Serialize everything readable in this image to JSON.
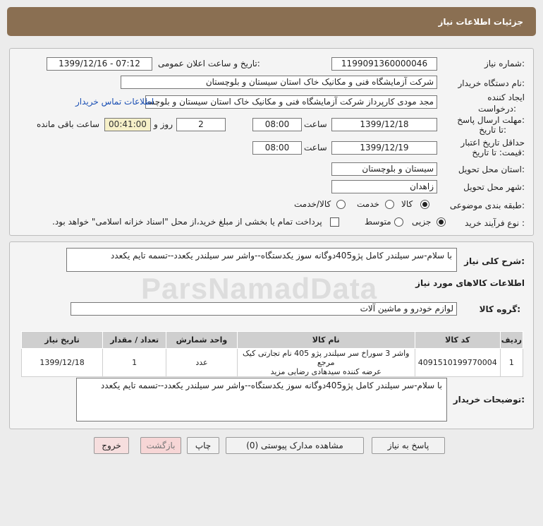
{
  "header": {
    "title": "جزئیات اطلاعات نیاز"
  },
  "info": {
    "need_number_label": "شماره نیاز:",
    "need_number": "1199091360000046",
    "announce_label": "تاریخ و ساعت اعلان عمومی:",
    "announce_value": "1399/12/16 - 07:12",
    "buyer_label": "نام دستگاه خریدار:",
    "buyer_value": "شرکت آزمایشگاه فنی و مکانیک خاک استان سیستان و بلوچستان",
    "creator_label_1": "ایجاد کننده",
    "creator_label_2": "درخواست:",
    "creator_value": "مجد مودی کارپرداز شرکت آزمایشگاه فنی و مکانیک خاک استان سیستان و بلوچستان",
    "contact_link": "اطلاعات تماس خریدار",
    "deadline_label_1": "مهلت ارسال پاسخ:",
    "deadline_label_2": "تا تاریخ:",
    "deadline_date": "1399/12/18",
    "time_label": "ساعت",
    "deadline_time": "08:00",
    "days_value": "2",
    "days_label": "روز و",
    "remaining_time": "00:41:00",
    "remaining_label": "ساعت باقی مانده",
    "validity_label_1": "حداقل تاریخ اعتبار",
    "validity_label_2": "قیمت: تا تاریخ:",
    "validity_date": "1399/12/19",
    "validity_time": "08:00",
    "province_label": "استان محل تحویل:",
    "province_value": "سیستان و بلوچستان",
    "city_label": "شهر محل تحویل:",
    "city_value": "زاهدان",
    "category_label": "طبقه بندی موضوعی:",
    "category_options": [
      "کالا",
      "خدمت",
      "کالا/خدمت"
    ],
    "purchase_label": "نوع فرآیند خرید :",
    "purchase_options": [
      "جزیی",
      "متوسط"
    ],
    "payment_note": "پرداخت تمام یا بخشی از مبلغ خرید،از محل \"اسناد خزانه اسلامی\" خواهد بود."
  },
  "description": {
    "label": "شرح کلی نیاز:",
    "value": "با سلام-سر سیلندر کامل پژو405دوگانه سوز یکدستگاه--واشر سر سیلندر یکعدد--تسمه تایم یکعدد"
  },
  "goods": {
    "section_title": "اطلاعات کالاهای مورد نیاز",
    "group_label": "گروه کالا:",
    "group_value": "لوازم خودرو و ماشین آلات",
    "table": {
      "headers": [
        "ردیف",
        "کد کالا",
        "نام کالا",
        "واحد شمارش",
        "تعداد / مقدار",
        "تاریخ نیاز"
      ],
      "rows": [
        {
          "row": "1",
          "code": "4091510199770004",
          "name_line1": "واشر 3 سوراخ سر سیلندر پژو 405 نام تجارتی کیک مرجع",
          "name_line2": "عرضه کننده سیدهادی رضایی مزید",
          "unit": "عدد",
          "qty": "1",
          "date": "1399/12/18"
        }
      ]
    }
  },
  "buyer_notes": {
    "label": "توضیحات خریدار:",
    "value": "با سلام-سر سیلندر کامل پژو405دوگانه سوز یکدستگاه--واشر سر سیلندر یکعدد--تسمه تایم یکعدد"
  },
  "buttons": {
    "reply": "پاسخ به نیاز",
    "view_docs": "مشاهده مدارک پیوستی (0)",
    "print": "چاپ",
    "back": "بازگشت",
    "exit": "خروج"
  },
  "watermark": "ParsNamadData"
}
